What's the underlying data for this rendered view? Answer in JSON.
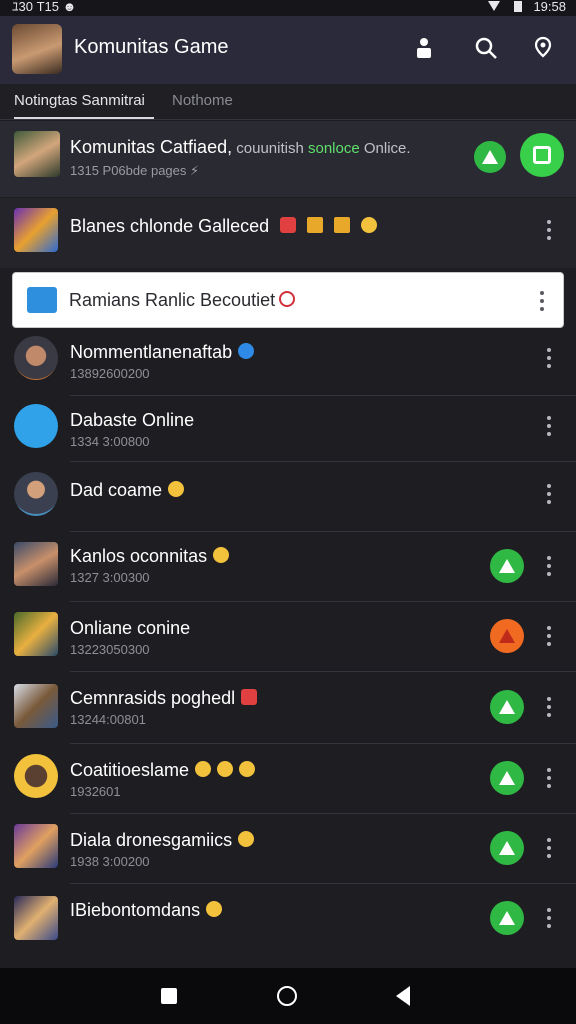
{
  "status_bar": {
    "left": "ﾕ30 T15  ☻",
    "right": "19:58"
  },
  "app_bar": {
    "title": "Komunitas Game",
    "icons": [
      "person-icon",
      "search-icon",
      "location-icon"
    ]
  },
  "tabs": [
    {
      "label": "Notingtas Sanmitrai",
      "active": true
    },
    {
      "label": "Nothome",
      "active": false
    }
  ],
  "featured": {
    "title": "Komunitas Catfiaed,",
    "sub1": " couunitish ",
    "sub2": "sonloce",
    "sub3": " Onlice.",
    "meta": "1315 P06bde pages ⚡"
  },
  "highlight_row": {
    "title": "Blanes chlonde Galleced"
  },
  "pinned": {
    "label": "Ramians Ranlic Becoutiet"
  },
  "rows": [
    {
      "name": "Nommentlanenaftab",
      "sub": "13892600200",
      "badge": "none"
    },
    {
      "name": "Dabaste Online",
      "sub": "1334 3:00800",
      "badge": "none"
    },
    {
      "name": "Dad coame",
      "sub": "",
      "badge": "none"
    },
    {
      "name": "Kanlos oconnitas",
      "sub": "1327 3:00300",
      "badge": "green"
    },
    {
      "name": "Onliane conine",
      "sub": "13223050300",
      "badge": "orange"
    },
    {
      "name": "Cemnrasids poghedl",
      "sub": "13244:00801",
      "badge": "green"
    },
    {
      "name": "Coatitioeslame",
      "sub": "1932601",
      "badge": "green"
    },
    {
      "name": "Diala dronesgamiics",
      "sub": "1938 3:00200",
      "badge": "green"
    },
    {
      "name": "IBiebontomdans",
      "sub": "",
      "badge": "green"
    }
  ],
  "colors": {
    "accent_green": "#2fb844",
    "accent_orange": "#f06a22",
    "app_bar": "#2b2a3a",
    "background": "#1e1e22"
  }
}
